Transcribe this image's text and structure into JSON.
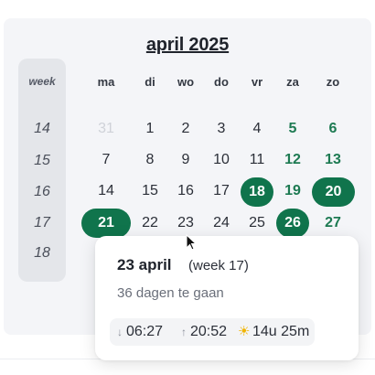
{
  "calendar": {
    "month_title": "april 2025",
    "week_header": "week",
    "weekdays": [
      "ma",
      "di",
      "wo",
      "do",
      "vr",
      "za",
      "zo"
    ],
    "weeks": [
      {
        "week": "14",
        "days": [
          "31",
          "1",
          "2",
          "3",
          "4",
          "5",
          "6"
        ]
      },
      {
        "week": "15",
        "days": [
          "7",
          "8",
          "9",
          "10",
          "11",
          "12",
          "13"
        ]
      },
      {
        "week": "16",
        "days": [
          "14",
          "15",
          "16",
          "17",
          "18",
          "19",
          "20"
        ]
      },
      {
        "week": "17",
        "days": [
          "21",
          "22",
          "23",
          "24",
          "25",
          "26",
          "27"
        ]
      },
      {
        "week": "18",
        "days": []
      }
    ]
  },
  "tooltip": {
    "date": "23 april",
    "week": "(week 17)",
    "countdown": "36 dagen te gaan",
    "sunrise": "06:27",
    "sunset": "20:52",
    "daylight": "14u 25m"
  },
  "colors": {
    "accent": "#10744c",
    "weekend": "#1d7a52",
    "panel": "#f4f5f8"
  },
  "icons": {
    "sunrise": "arrow-down-icon",
    "sunset": "arrow-up-icon",
    "daylight": "sun-icon"
  }
}
